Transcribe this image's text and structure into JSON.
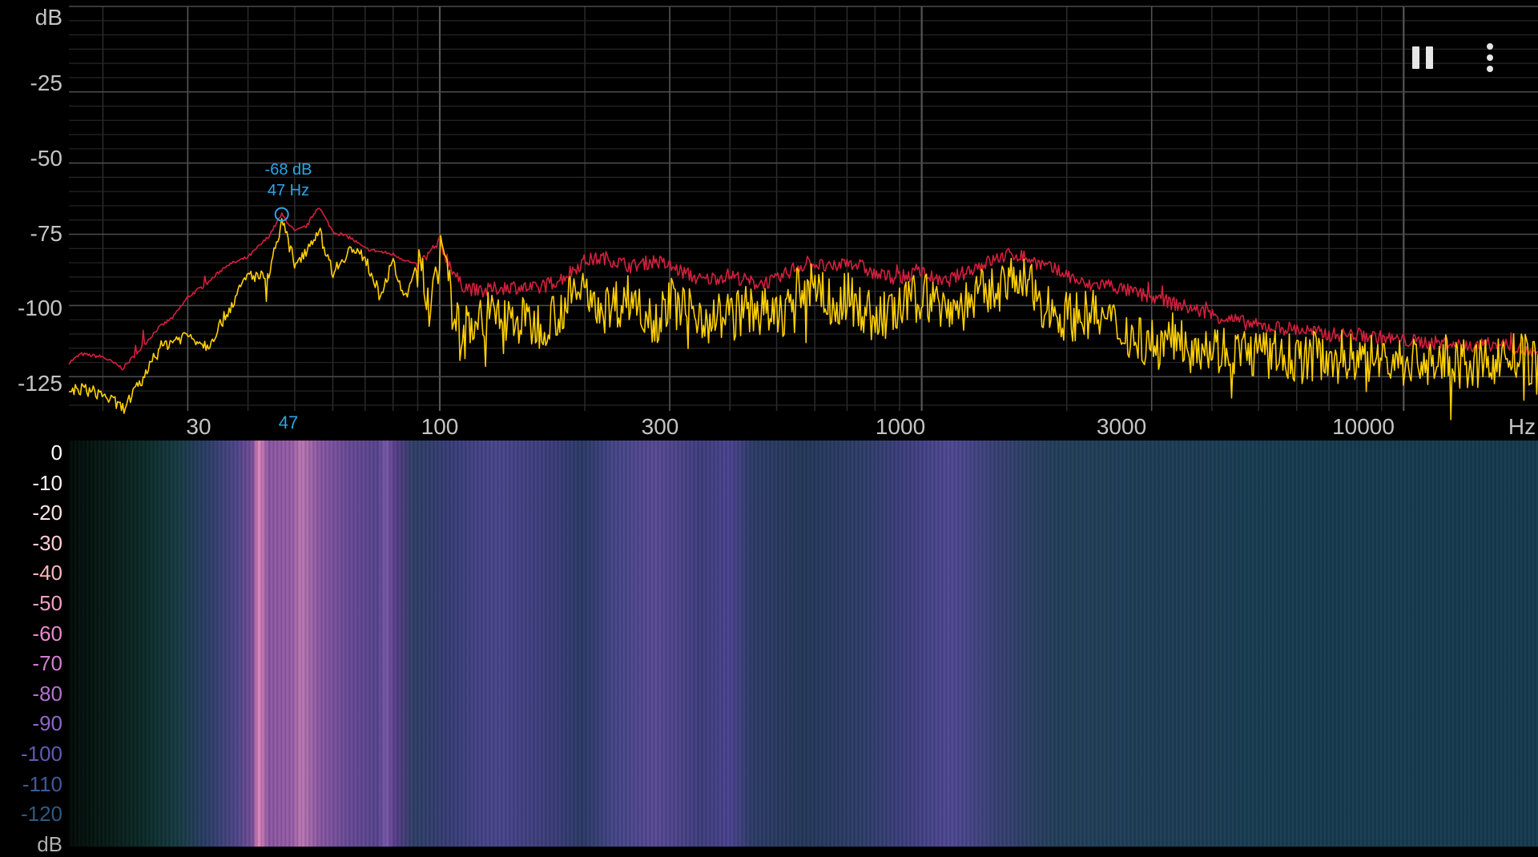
{
  "spectrum": {
    "y_unit": "dB",
    "y_ticks": [
      {
        "label": "-25",
        "value": -25
      },
      {
        "label": "-50",
        "value": -50
      },
      {
        "label": "-75",
        "value": -75
      },
      {
        "label": "-100",
        "value": -100
      },
      {
        "label": "-125",
        "value": -125
      }
    ],
    "x_unit": "Hz",
    "x_ticks": [
      {
        "label": "30",
        "value": 30
      },
      {
        "label": "100",
        "value": 100
      },
      {
        "label": "300",
        "value": 300
      },
      {
        "label": "1000",
        "value": 1000
      },
      {
        "label": "3000",
        "value": 3000
      },
      {
        "label": "10000",
        "value": 10000
      }
    ],
    "marker": {
      "db_label": "-68 dB",
      "hz_label": "47 Hz",
      "axis_label": "47",
      "freq": 47,
      "db": -68,
      "color": "#2aa6e6"
    },
    "peak_color": "#d21f3c",
    "live_color": "#ffd000",
    "grid_color": "#3a3a3a"
  },
  "controls": {
    "pause_icon": "pause-icon",
    "more_icon": "more-vertical-icon"
  },
  "colorbar": {
    "labels": [
      {
        "text": "0",
        "color": "#ffffff"
      },
      {
        "text": "-10",
        "color": "#fff2f6"
      },
      {
        "text": "-20",
        "color": "#ffe3ea"
      },
      {
        "text": "-30",
        "color": "#ffcfd8"
      },
      {
        "text": "-40",
        "color": "#f8b7ba"
      },
      {
        "text": "-50",
        "color": "#f3a0c6"
      },
      {
        "text": "-60",
        "color": "#e78bcc"
      },
      {
        "text": "-70",
        "color": "#d27fd0"
      },
      {
        "text": "-80",
        "color": "#b373cf"
      },
      {
        "text": "-90",
        "color": "#8b68c8"
      },
      {
        "text": "-100",
        "color": "#5f5ab4"
      },
      {
        "text": "-110",
        "color": "#3f5a9a"
      },
      {
        "text": "-120",
        "color": "#2d5a82"
      }
    ],
    "unit": "dB",
    "unit_color": "#b0b0b0"
  },
  "chart_data": {
    "type": "line",
    "x_scale": "log",
    "xlim": [
      17,
      19000
    ],
    "ylim": [
      -137,
      5
    ],
    "ylabel": "dB",
    "xlabel": "Hz",
    "series": [
      {
        "color": "#d21f3c",
        "x": [
          17,
          18,
          20,
          22,
          24,
          26,
          28,
          30,
          33,
          36,
          40,
          44,
          47,
          50,
          53,
          56,
          60,
          65,
          70,
          80,
          90,
          100,
          110,
          120,
          140,
          160,
          180,
          200,
          220,
          250,
          280,
          300,
          350,
          400,
          450,
          500,
          550,
          600,
          650,
          700,
          750,
          800,
          900,
          1000,
          1100,
          1200,
          1300,
          1400,
          1500,
          1600,
          1700,
          1800,
          2000,
          2200,
          2400,
          2600,
          3000,
          3500,
          4000,
          5000,
          6000,
          7000,
          8000,
          10000,
          12000,
          14000,
          16000,
          18000,
          19000
        ],
        "y": [
          -120,
          -117,
          -118,
          -122,
          -115,
          -108,
          -104,
          -97,
          -92,
          -86,
          -83,
          -76,
          -68,
          -74,
          -72,
          -65,
          -74,
          -76,
          -80,
          -82,
          -86,
          -78,
          -92,
          -95,
          -93,
          -94,
          -90,
          -84,
          -83,
          -86,
          -84,
          -86,
          -91,
          -89,
          -92,
          -91,
          -86,
          -85,
          -87,
          -84,
          -86,
          -89,
          -90,
          -88,
          -92,
          -89,
          -86,
          -84,
          -82,
          -82,
          -84,
          -86,
          -89,
          -93,
          -92,
          -94,
          -97,
          -100,
          -103,
          -107,
          -108,
          -110,
          -110,
          -112,
          -113,
          -114,
          -113,
          -116,
          -118
        ]
      },
      {
        "color": "#ffd000",
        "x": [
          17,
          18,
          20,
          22,
          24,
          26,
          28,
          30,
          33,
          36,
          38,
          40,
          44,
          47,
          50,
          53,
          56,
          60,
          65,
          70,
          75,
          80,
          85,
          90,
          95,
          100,
          110,
          120,
          140,
          160,
          180,
          200,
          220,
          250,
          280,
          300,
          350,
          400,
          450,
          500,
          550,
          600,
          650,
          700,
          750,
          800,
          900,
          1000,
          1100,
          1200,
          1300,
          1400,
          1500,
          1600,
          1700,
          1800,
          2000,
          2200,
          2400,
          2600,
          3000,
          3500,
          4000,
          5000,
          6000,
          7000,
          8000,
          10000,
          12000,
          14000,
          16000,
          18000,
          19000
        ],
        "y": [
          -130,
          -129,
          -131,
          -136,
          -127,
          -115,
          -112,
          -110,
          -114,
          -103,
          -96,
          -89,
          -90,
          -70,
          -85,
          -80,
          -73,
          -88,
          -80,
          -83,
          -96,
          -85,
          -98,
          -84,
          -100,
          -80,
          -110,
          -102,
          -104,
          -106,
          -100,
          -92,
          -100,
          -96,
          -104,
          -98,
          -102,
          -103,
          -100,
          -104,
          -95,
          -90,
          -100,
          -96,
          -100,
          -104,
          -101,
          -95,
          -99,
          -100,
          -96,
          -94,
          -91,
          -90,
          -94,
          -99,
          -103,
          -102,
          -104,
          -108,
          -112,
          -110,
          -114,
          -116,
          -118,
          -116,
          -117,
          -119,
          -118,
          -121,
          -117,
          -118,
          -121
        ]
      }
    ]
  }
}
